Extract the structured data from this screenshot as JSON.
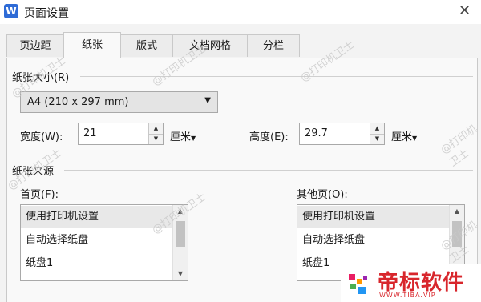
{
  "window": {
    "app_icon": "W",
    "title": "页面设置",
    "close": "✕"
  },
  "tabs": [
    {
      "label": "页边距",
      "active": false
    },
    {
      "label": "纸张",
      "active": true
    },
    {
      "label": "版式",
      "active": false
    },
    {
      "label": "文档网格",
      "active": false
    },
    {
      "label": "分栏",
      "active": false
    }
  ],
  "paper_size": {
    "group_label": "纸张大小(R)",
    "selected": "A4 (210 x 297 mm)",
    "width_label": "宽度(W):",
    "width_value": "21",
    "width_unit": "厘米",
    "height_label": "高度(E):",
    "height_value": "29.7",
    "height_unit": "厘米"
  },
  "paper_source": {
    "group_label": "纸张来源",
    "first_page_label": "首页(F):",
    "other_pages_label": "其他页(O):",
    "first_page_items": [
      "使用打印机设置",
      "自动选择纸盘",
      "纸盘1"
    ],
    "other_pages_items": [
      "使用打印机设置",
      "自动选择纸盘",
      "纸盘1"
    ]
  },
  "watermark": "@打印机卫士",
  "brand": {
    "name": "帝标软件",
    "sub": "WWW.TIBA.VIP"
  },
  "colors": {
    "brand_red": "#d8262c",
    "app_blue": "#2e6bd6"
  }
}
